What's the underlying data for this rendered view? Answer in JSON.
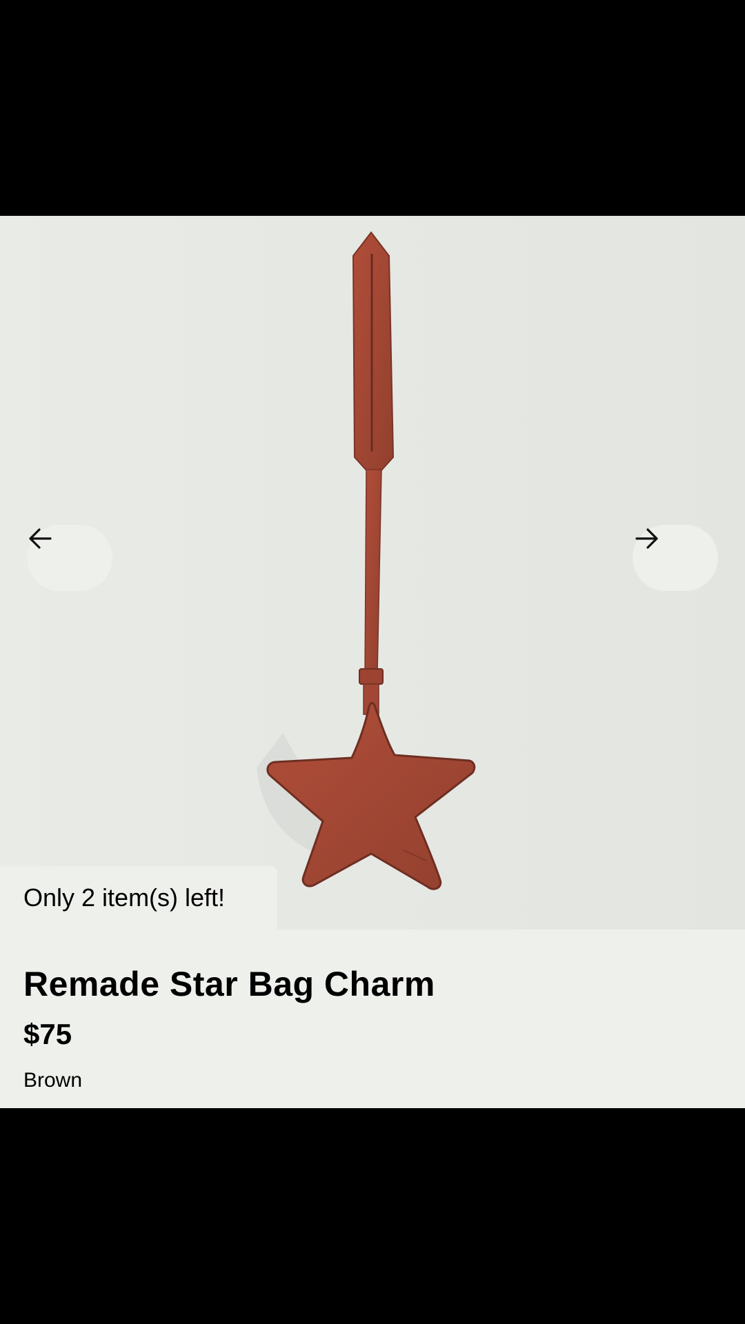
{
  "product": {
    "title": "Remade Star Bag Charm",
    "price": "$75",
    "color": "Brown",
    "stock_message": "Only 2 item(s) left!",
    "image_subject": "brown leather star bag charm"
  },
  "carousel": {
    "prev_icon": "arrow-left-icon",
    "next_icon": "arrow-right-icon"
  },
  "colors": {
    "background": "#000000",
    "card": "#eef0ec",
    "leather": "#a64734",
    "text": "#000000"
  }
}
